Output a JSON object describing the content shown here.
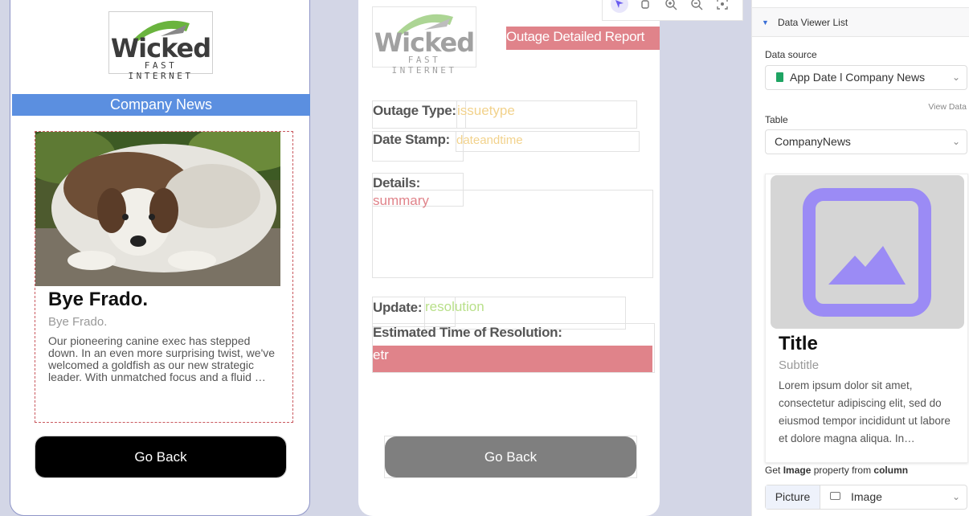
{
  "left_screen": {
    "logo": {
      "word": "Wicked",
      "tagline": "FAST INTERNET"
    },
    "header": "Company News",
    "card": {
      "title": "Bye Frado.",
      "subtitle": "Bye Frado.",
      "body": "Our pioneering canine exec has stepped down. In an even more surprising twist, we've welcomed a goldfish as our new strategic leader. With unmatched focus and a fluid …"
    },
    "back_button": "Go Back"
  },
  "middle_screen": {
    "logo": {
      "word": "Wicked",
      "tagline": "FAST INTERNET"
    },
    "report_title": "Outage Detailed Report",
    "outage_type": {
      "label": "Outage Type:",
      "value": "issuetype"
    },
    "date_stamp": {
      "label": "Date Stamp:",
      "value": "dateandtime"
    },
    "details": {
      "label": "Details:",
      "value": "summary"
    },
    "update": {
      "label": "Update:",
      "value": "resolution"
    },
    "etr": {
      "label": "Estimated Time of Resolution:",
      "value": "etr"
    },
    "back_button": "Go Back"
  },
  "toolbar": {
    "icons": [
      "pointer-icon",
      "hand-icon",
      "zoom-in-icon",
      "zoom-out-icon",
      "fit-screen-icon"
    ]
  },
  "panel": {
    "section_title": "Data Viewer List",
    "data_source_label": "Data source",
    "data_source_value": "App Date l Company News",
    "view_data": "View Data",
    "table_label": "Table",
    "table_value": "CompanyNews",
    "preview": {
      "title": "Title",
      "subtitle": "Subtitle",
      "body": "Lorem ipsum dolor sit amet, consectetur adipiscing elit, sed do eiusmod tempor incididunt ut labore et dolore magna aliqua. In…"
    },
    "column_hint": {
      "prefix": "Get ",
      "bold1": "Image",
      "middle": " property from ",
      "bold2": "column"
    },
    "segment_left": "Picture",
    "segment_right": "Image"
  },
  "colors": {
    "accent_blue": "#5b8fe0",
    "accent_red": "#e0838a",
    "placeholder_purple": "#9b8bf5",
    "logo_green": "#6ab43e"
  }
}
